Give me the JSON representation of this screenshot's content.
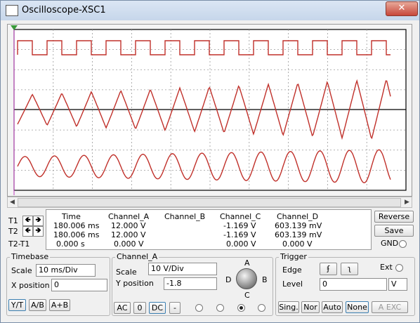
{
  "window": {
    "title": "Oscilloscope-XSC1",
    "close": "✕"
  },
  "scope": {
    "trace_color": "#c0302a",
    "marker_color": "#3a9a3a"
  },
  "measurements": {
    "row_labels": [
      "T1",
      "T2",
      "T2-T1"
    ],
    "headers": {
      "time": "Time",
      "a": "Channel_A",
      "b": "Channel_B",
      "c": "Channel_C",
      "d": "Channel_D"
    },
    "rows": [
      {
        "time": "180.006 ms",
        "a": "12.000 V",
        "b": "",
        "c": "-1.169 V",
        "d": "603.139 mV"
      },
      {
        "time": "180.006 ms",
        "a": "12.000 V",
        "b": "",
        "c": "-1.169 V",
        "d": "603.139 mV"
      },
      {
        "time": "0.000 s",
        "a": "0.000 V",
        "b": "",
        "c": "0.000 V",
        "d": "0.000 V"
      }
    ],
    "arrow_left": "🡸",
    "arrow_right": "🡺"
  },
  "buttons": {
    "reverse": "Reverse",
    "save": "Save",
    "gnd": "GND"
  },
  "timebase": {
    "legend": "Timebase",
    "scale_label": "Scale",
    "scale_value": "10 ms/Div",
    "xpos_label": "X position",
    "xpos_value": "0",
    "modes": [
      "Y/T",
      "A/B",
      "A+B"
    ]
  },
  "channel": {
    "legend": "Channel_A",
    "scale_label": "Scale",
    "scale_value": "10  V/Div",
    "ypos_label": "Y position",
    "ypos_value": "-1.8",
    "coupling": [
      "AC",
      "0",
      "DC",
      "-"
    ],
    "knob_labels": {
      "a": "A",
      "b": "B",
      "c": "C",
      "d": "D"
    }
  },
  "trigger": {
    "legend": "Trigger",
    "edge_label": "Edge",
    "rise_glyph": "ʄ",
    "fall_glyph": "ʅ",
    "ext_label": "Ext",
    "level_label": "Level",
    "level_value": "0",
    "level_unit": "V",
    "modes": [
      "Sing.",
      "Nor",
      "Auto",
      "None"
    ],
    "ext_btn": "A  EXC"
  }
}
